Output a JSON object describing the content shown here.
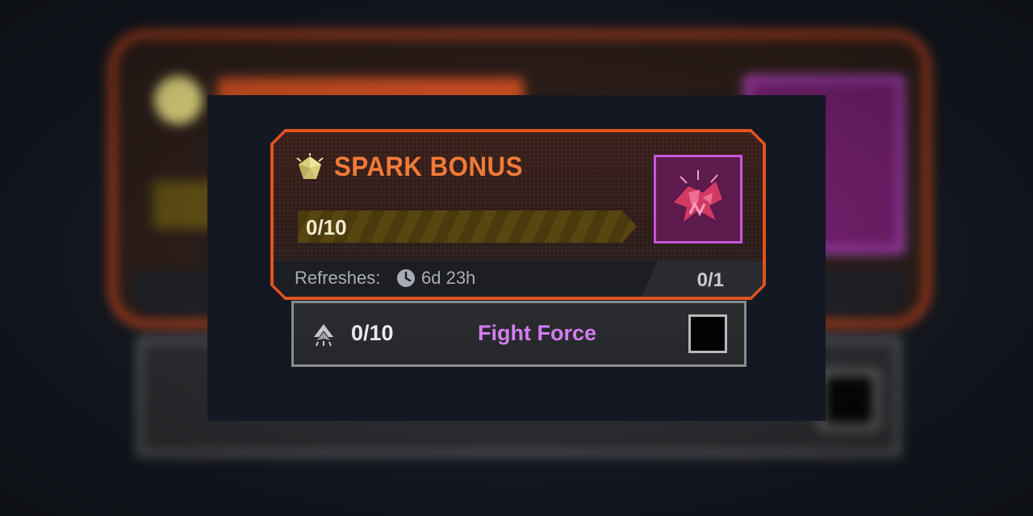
{
  "card": {
    "title": "SPARK BONUS",
    "progress_text": "0/10",
    "progress_fraction": 0,
    "refresh_label": "Refreshes:",
    "refresh_time": "6d 23h",
    "count": "0/1",
    "icons": {
      "gem": "spark-gem-icon",
      "clock": "clock-icon",
      "reward": "reward-charm-icon"
    }
  },
  "task": {
    "progress": "0/10",
    "name": "Fight Force",
    "icon": "squad-chevron-icon",
    "checked": false
  },
  "colors": {
    "accent_orange": "#e1531e",
    "title_orange": "#f07a38",
    "progress_gold": "#d7b12a",
    "reward_purple": "#c856de",
    "task_name_purple": "#d37cf0"
  }
}
